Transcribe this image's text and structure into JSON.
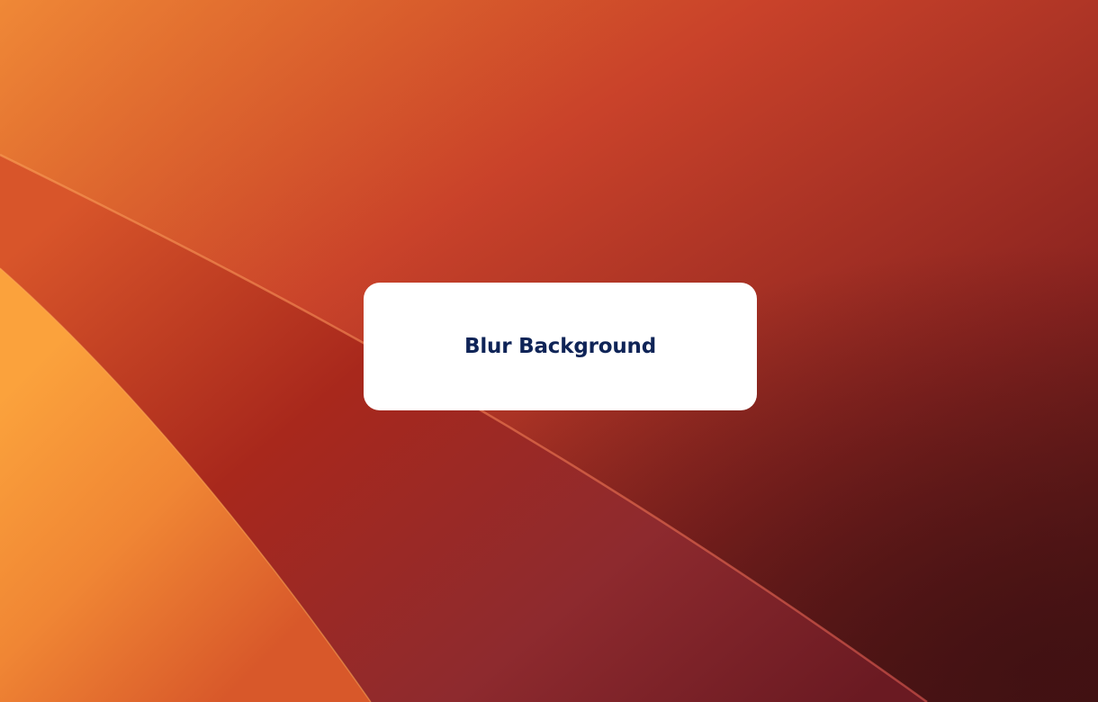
{
  "card": {
    "label": "Blur Background"
  },
  "colors": {
    "card_background": "#ffffff",
    "label_text": "#0f2457",
    "wallpaper_orange": "#f59a3a",
    "wallpaper_red": "#c4422a",
    "wallpaper_dark": "#4e1414"
  }
}
